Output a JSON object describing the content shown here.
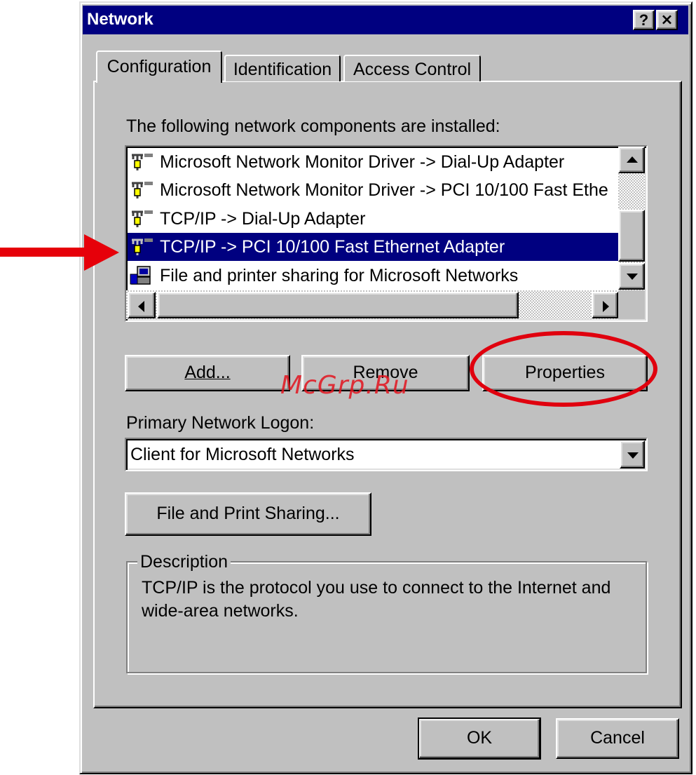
{
  "window": {
    "title": "Network",
    "help_label": "?",
    "close_label": "×"
  },
  "tabs": [
    {
      "label": "Configuration",
      "active": true
    },
    {
      "label": "Identification",
      "active": false
    },
    {
      "label": "Access Control",
      "active": false
    }
  ],
  "components": {
    "label": "The following network components are installed:",
    "items": [
      {
        "icon": "network-adapter-icon",
        "label": "Microsoft Network Monitor Driver -> Dial-Up Adapter",
        "selected": false
      },
      {
        "icon": "network-adapter-icon",
        "label": "Microsoft Network Monitor Driver -> PCI 10/100 Fast Ethe",
        "selected": false
      },
      {
        "icon": "network-adapter-icon",
        "label": "TCP/IP -> Dial-Up Adapter",
        "selected": false
      },
      {
        "icon": "network-adapter-icon",
        "label": "TCP/IP -> PCI 10/100 Fast Ethernet Adapter",
        "selected": true
      },
      {
        "icon": "file-printer-sharing-icon",
        "label": "File and printer sharing for Microsoft Networks",
        "selected": false
      }
    ]
  },
  "buttons": {
    "add": "Add...",
    "remove": "Remove",
    "properties": "Properties",
    "file_print_sharing": "File and Print Sharing...",
    "ok": "OK",
    "cancel": "Cancel"
  },
  "logon": {
    "label": "Primary Network Logon:",
    "value": "Client for Microsoft Networks"
  },
  "description": {
    "legend": "Description",
    "text_line1": "TCP/IP is the protocol you use to connect to the Internet and",
    "text_line2": "wide-area networks."
  },
  "watermark": "McGrp.Ru",
  "annotation_color": "#e3141e",
  "selection_color": "#000080"
}
